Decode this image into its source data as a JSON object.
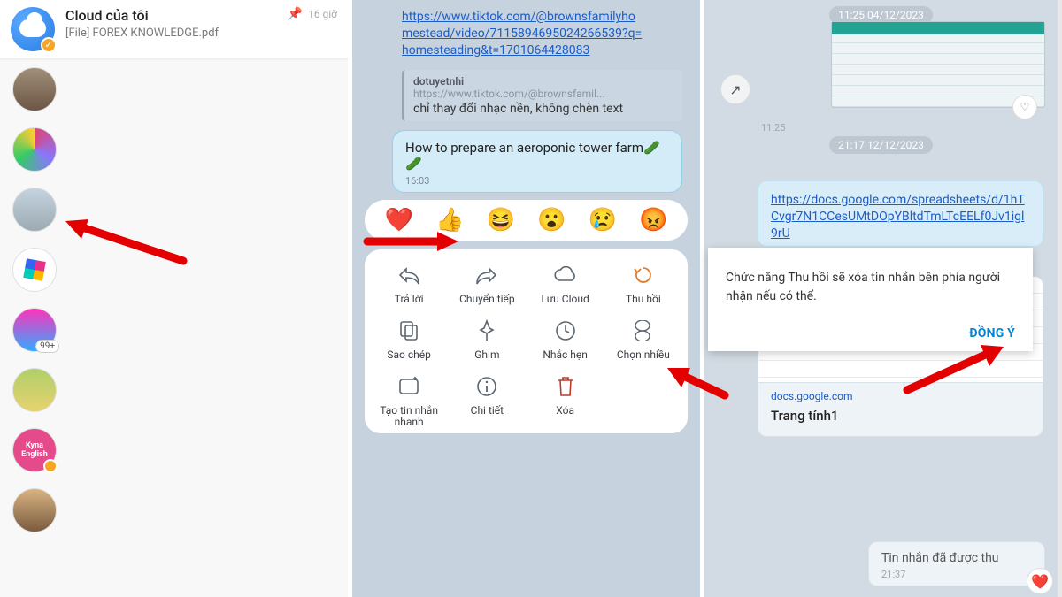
{
  "panel1": {
    "header_title": "Cloud của tôi",
    "header_sub": "[File] FOREX KNOWLEDGE.pdf",
    "time": "16 giờ",
    "avatar5_badge": "99+",
    "avatar7_text": "Kyna English"
  },
  "panel2": {
    "link_text": "https://www.tiktok.com/@brownsfamilyhomestead/video/7115894695024266539?q=homesteading&t=1701064428083",
    "quote_name": "dotuyetnhi",
    "quote_url": "https://www.tiktok.com/@brownsfamil...",
    "quote_body": "chỉ thay đổi nhạc nền, không chèn text",
    "focus_text": "How to prepare an aeroponic tower farm🥒🥒",
    "focus_time": "16:03",
    "reactions": {
      "heart": "❤️",
      "thumb": "👍",
      "laugh": "😆",
      "wow": "😮",
      "cry": "😢",
      "angry": "😡"
    },
    "actions": {
      "reply": "Trả lời",
      "forward": "Chuyển tiếp",
      "cloud": "Lưu Cloud",
      "recall": "Thu hồi",
      "copy": "Sao chép",
      "pin": "Ghim",
      "remind": "Nhắc hẹn",
      "multi": "Chọn nhiều",
      "quick": "Tạo tin nhắn nhanh",
      "info": "Chi tiết",
      "delete": "Xóa"
    }
  },
  "panel3": {
    "date1": "11:25 04/12/2023",
    "time1": "11:25",
    "date2": "21:17 12/12/2023",
    "link": "https://docs.google.com/spreadsheets/d/1hTCvgr7N1CCesUMtDOpYBltdTmLTcEELf0Jv1igl9rU",
    "preview_domain": "docs.google.com",
    "preview_title": "Trang tính1",
    "dialog_text": "Chức năng Thu hồi sẽ xóa tin nhắn bên phía người nhận nếu có thể.",
    "dialog_agree": "ĐỒNG Ý",
    "recall_text": "Tin nhắn đã được thu",
    "recall_time": "21:37"
  }
}
